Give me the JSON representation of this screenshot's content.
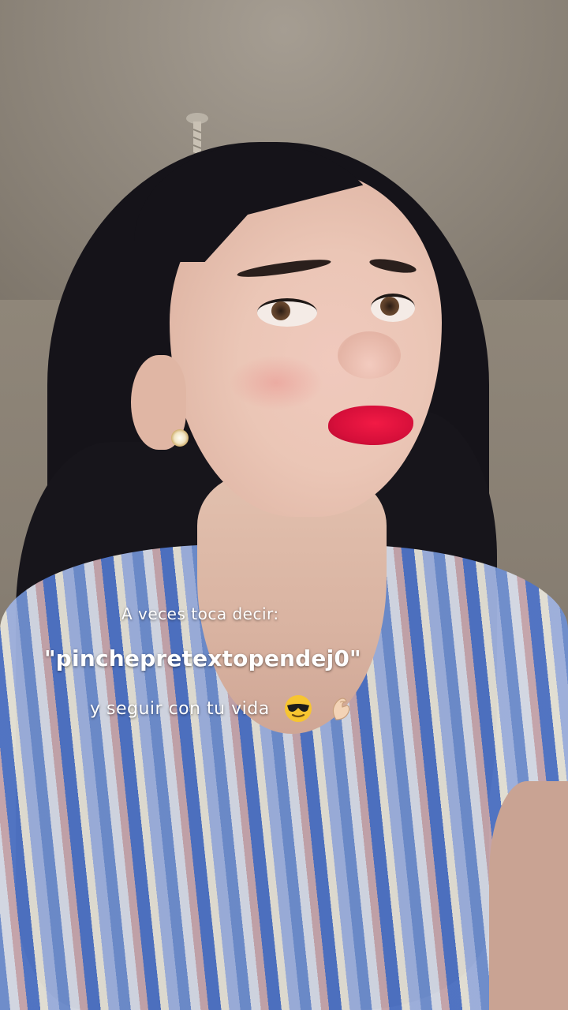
{
  "overlay": {
    "line1": "A veces toca decir:",
    "line2": "\"pinchepretextopendej0\"",
    "line3": "y seguir con tu vida",
    "emoji1": "sunglasses-emoji",
    "emoji2": "pinched-fingers-emoji"
  }
}
